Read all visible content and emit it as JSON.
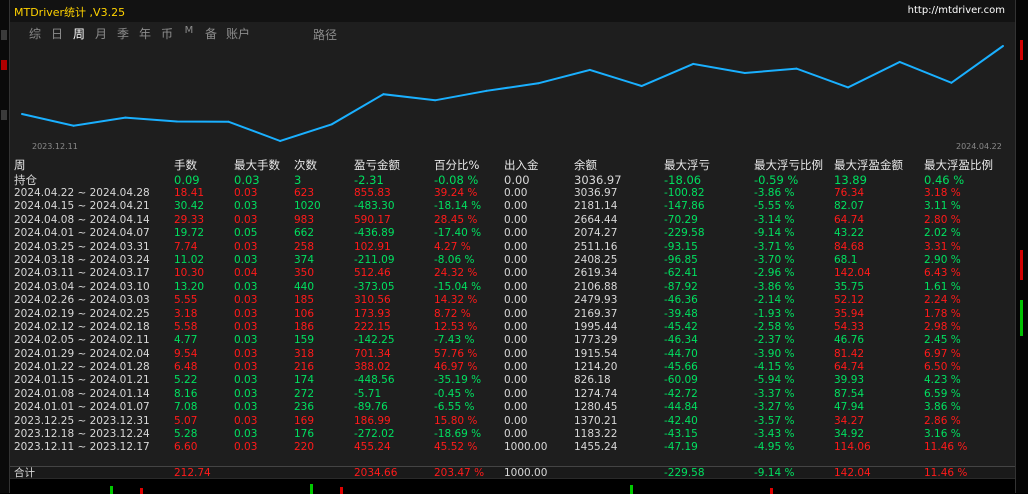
{
  "window": {
    "title": "MTDriver统计 ,V3.25",
    "url": "http://mtdriver.com"
  },
  "tabs": [
    {
      "label": "综",
      "active": false
    },
    {
      "label": "日",
      "active": false
    },
    {
      "label": "周",
      "active": true
    },
    {
      "label": "月",
      "active": false
    },
    {
      "label": "季",
      "active": false
    },
    {
      "label": "年",
      "active": false
    },
    {
      "label": "币",
      "active": false
    },
    {
      "label": "M",
      "active": false
    },
    {
      "label": "备",
      "active": false
    },
    {
      "label": "账户",
      "active": false
    }
  ],
  "path_tab": "路径",
  "chart_data": {
    "type": "line",
    "x_start_label": "2023.12.11",
    "x_end_label": "2024.04.22",
    "color": "#1ab0ff",
    "x": [
      "2023.12.11",
      "2023.12.18",
      "2023.12.25",
      "2024.01.01",
      "2024.01.08",
      "2024.01.15",
      "2024.01.22",
      "2024.01.29",
      "2024.02.05",
      "2024.02.12",
      "2024.02.19",
      "2024.02.26",
      "2024.03.04",
      "2024.03.11",
      "2024.03.18",
      "2024.03.25",
      "2024.04.01",
      "2024.04.08",
      "2024.04.15",
      "2024.04.22"
    ],
    "values": [
      1455.24,
      1183.22,
      1370.21,
      1280.45,
      1274.74,
      826.18,
      1214.2,
      1915.54,
      1773.29,
      1995.44,
      2169.37,
      2479.93,
      2106.88,
      2619.34,
      2408.25,
      2511.16,
      2074.27,
      2664.44,
      2181.14,
      3036.97
    ]
  },
  "table": {
    "headers": [
      "周",
      "手数",
      "最大手数",
      "次数",
      "盈亏金额",
      "百分比%",
      "出入金",
      "余额",
      "最大浮亏",
      "最大浮亏比例",
      "最大浮盈金额",
      "最大浮盈比例"
    ],
    "holding": {
      "cells": [
        "持仓",
        "0.09",
        "0.03",
        "3",
        "-2.31",
        "-0.08 %",
        "0.00",
        "3036.97",
        "-18.06",
        "-0.59 %",
        "13.89",
        "0.46 %"
      ],
      "sign": "neg"
    },
    "rows": [
      {
        "cells": [
          "2024.04.22 ~ 2024.04.28",
          "18.41",
          "0.03",
          "623",
          "855.83",
          "39.24 %",
          "0.00",
          "3036.97",
          "-100.82",
          "-3.86 %",
          "76.34",
          "3.18 %"
        ],
        "sign": "pos"
      },
      {
        "cells": [
          "2024.04.15 ~ 2024.04.21",
          "30.42",
          "0.03",
          "1020",
          "-483.30",
          "-18.14 %",
          "0.00",
          "2181.14",
          "-147.86",
          "-5.55 %",
          "82.07",
          "3.11 %"
        ],
        "sign": "neg"
      },
      {
        "cells": [
          "2024.04.08 ~ 2024.04.14",
          "29.33",
          "0.03",
          "983",
          "590.17",
          "28.45 %",
          "0.00",
          "2664.44",
          "-70.29",
          "-3.14 %",
          "64.74",
          "2.80 %"
        ],
        "sign": "pos"
      },
      {
        "cells": [
          "2024.04.01 ~ 2024.04.07",
          "19.72",
          "0.05",
          "662",
          "-436.89",
          "-17.40 %",
          "0.00",
          "2074.27",
          "-229.58",
          "-9.14 %",
          "43.22",
          "2.02 %"
        ],
        "sign": "neg"
      },
      {
        "cells": [
          "2024.03.25 ~ 2024.03.31",
          "7.74",
          "0.03",
          "258",
          "102.91",
          "4.27 %",
          "0.00",
          "2511.16",
          "-93.15",
          "-3.71 %",
          "84.68",
          "3.31 %"
        ],
        "sign": "pos"
      },
      {
        "cells": [
          "2024.03.18 ~ 2024.03.24",
          "11.02",
          "0.03",
          "374",
          "-211.09",
          "-8.06 %",
          "0.00",
          "2408.25",
          "-96.85",
          "-3.70 %",
          "68.1",
          "2.90 %"
        ],
        "sign": "neg"
      },
      {
        "cells": [
          "2024.03.11 ~ 2024.03.17",
          "10.30",
          "0.04",
          "350",
          "512.46",
          "24.32 %",
          "0.00",
          "2619.34",
          "-62.41",
          "-2.96 %",
          "142.04",
          "6.43 %"
        ],
        "sign": "pos"
      },
      {
        "cells": [
          "2024.03.04 ~ 2024.03.10",
          "13.20",
          "0.03",
          "440",
          "-373.05",
          "-15.04 %",
          "0.00",
          "2106.88",
          "-87.92",
          "-3.86 %",
          "35.75",
          "1.61 %"
        ],
        "sign": "neg"
      },
      {
        "cells": [
          "2024.02.26 ~ 2024.03.03",
          "5.55",
          "0.03",
          "185",
          "310.56",
          "14.32 %",
          "0.00",
          "2479.93",
          "-46.36",
          "-2.14 %",
          "52.12",
          "2.24 %"
        ],
        "sign": "pos"
      },
      {
        "cells": [
          "2024.02.19 ~ 2024.02.25",
          "3.18",
          "0.03",
          "106",
          "173.93",
          "8.72 %",
          "0.00",
          "2169.37",
          "-39.48",
          "-1.93 %",
          "35.94",
          "1.78 %"
        ],
        "sign": "pos"
      },
      {
        "cells": [
          "2024.02.12 ~ 2024.02.18",
          "5.58",
          "0.03",
          "186",
          "222.15",
          "12.53 %",
          "0.00",
          "1995.44",
          "-45.42",
          "-2.58 %",
          "54.33",
          "2.98 %"
        ],
        "sign": "pos"
      },
      {
        "cells": [
          "2024.02.05 ~ 2024.02.11",
          "4.77",
          "0.03",
          "159",
          "-142.25",
          "-7.43 %",
          "0.00",
          "1773.29",
          "-46.34",
          "-2.37 %",
          "46.76",
          "2.45 %"
        ],
        "sign": "neg"
      },
      {
        "cells": [
          "2024.01.29 ~ 2024.02.04",
          "9.54",
          "0.03",
          "318",
          "701.34",
          "57.76 %",
          "0.00",
          "1915.54",
          "-44.70",
          "-3.90 %",
          "81.42",
          "6.97 %"
        ],
        "sign": "pos"
      },
      {
        "cells": [
          "2024.01.22 ~ 2024.01.28",
          "6.48",
          "0.03",
          "216",
          "388.02",
          "46.97 %",
          "0.00",
          "1214.20",
          "-45.66",
          "-4.15 %",
          "64.74",
          "6.50 %"
        ],
        "sign": "pos"
      },
      {
        "cells": [
          "2024.01.15 ~ 2024.01.21",
          "5.22",
          "0.03",
          "174",
          "-448.56",
          "-35.19 %",
          "0.00",
          "826.18",
          "-60.09",
          "-5.94 %",
          "39.93",
          "4.23 %"
        ],
        "sign": "neg"
      },
      {
        "cells": [
          "2024.01.08 ~ 2024.01.14",
          "8.16",
          "0.03",
          "272",
          "-5.71",
          "-0.45 %",
          "0.00",
          "1274.74",
          "-42.72",
          "-3.37 %",
          "87.54",
          "6.59 %"
        ],
        "sign": "neg"
      },
      {
        "cells": [
          "2024.01.01 ~ 2024.01.07",
          "7.08",
          "0.03",
          "236",
          "-89.76",
          "-6.55 %",
          "0.00",
          "1280.45",
          "-44.84",
          "-3.27 %",
          "47.94",
          "3.86 %"
        ],
        "sign": "neg"
      },
      {
        "cells": [
          "2023.12.25 ~ 2023.12.31",
          "5.07",
          "0.03",
          "169",
          "186.99",
          "15.80 %",
          "0.00",
          "1370.21",
          "-42.40",
          "-3.57 %",
          "34.27",
          "2.86 %"
        ],
        "sign": "pos"
      },
      {
        "cells": [
          "2023.12.18 ~ 2023.12.24",
          "5.28",
          "0.03",
          "176",
          "-272.02",
          "-18.69 %",
          "0.00",
          "1183.22",
          "-43.15",
          "-3.43 %",
          "34.92",
          "3.16 %"
        ],
        "sign": "neg"
      },
      {
        "cells": [
          "2023.12.11 ~ 2023.12.17",
          "6.60",
          "0.03",
          "220",
          "455.24",
          "45.52 %",
          "1000.00",
          "1455.24",
          "-47.19",
          "-4.95 %",
          "114.06",
          "11.46 %"
        ],
        "sign": "pos"
      }
    ],
    "total": {
      "cells": [
        "合计",
        "212.74",
        "",
        "",
        "2034.66",
        "203.47 %",
        "1000.00",
        "",
        "-229.58",
        "-9.14 %",
        "142.04",
        "11.46 %"
      ],
      "sign": "pos"
    }
  }
}
